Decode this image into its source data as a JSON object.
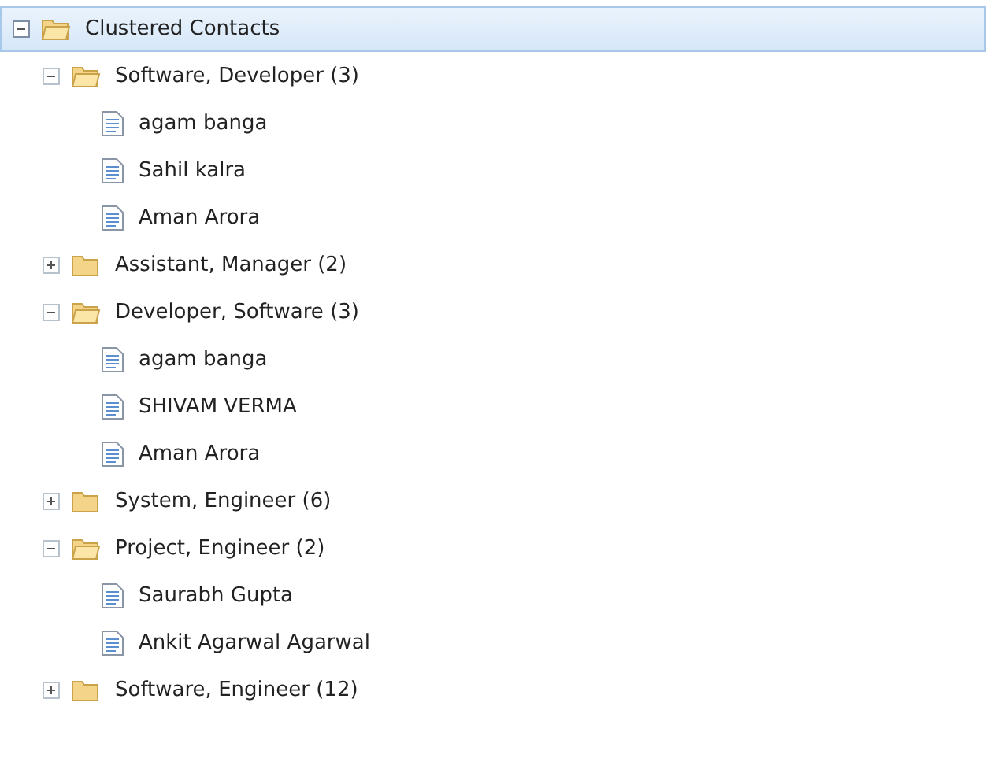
{
  "tree": [
    {
      "label": "Clustered Contacts",
      "expanded": true,
      "selected": true,
      "children": [
        {
          "label": "Software, Developer (3)",
          "expanded": true,
          "selected": false,
          "children": [
            {
              "label": "agam banga",
              "selected": false
            },
            {
              "label": "Sahil kalra",
              "selected": false
            },
            {
              "label": "Aman Arora",
              "selected": false
            }
          ]
        },
        {
          "label": "Assistant, Manager (2)",
          "expanded": false,
          "selected": false
        },
        {
          "label": "Developer, Software (3)",
          "expanded": true,
          "selected": false,
          "children": [
            {
              "label": "agam banga",
              "selected": false
            },
            {
              "label": "SHIVAM VERMA",
              "selected": false
            },
            {
              "label": "Aman Arora",
              "selected": false
            }
          ]
        },
        {
          "label": "System, Engineer (6)",
          "expanded": false,
          "selected": false
        },
        {
          "label": "Project, Engineer (2)",
          "expanded": true,
          "selected": false,
          "children": [
            {
              "label": "Saurabh Gupta",
              "selected": false
            },
            {
              "label": "Ankit Agarwal Agarwal",
              "selected": false
            }
          ]
        },
        {
          "label": "Software, Engineer (12)",
          "expanded": false,
          "selected": false
        }
      ]
    }
  ]
}
